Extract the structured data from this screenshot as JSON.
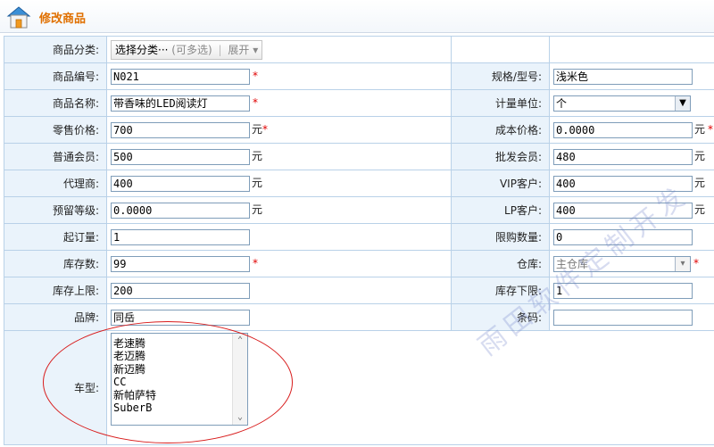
{
  "header": {
    "title": "修改商品",
    "icon": "home-icon"
  },
  "form": {
    "category": {
      "label": "商品分类:",
      "button_label": "选择分类···",
      "hint": "(可多选)",
      "expand_label": "展开"
    },
    "code": {
      "label": "商品编号:",
      "value": "N021"
    },
    "spec": {
      "label": "规格/型号:",
      "value": "浅米色"
    },
    "name": {
      "label": "商品名称:",
      "value": "带香味的LED阅读灯"
    },
    "unit_measure": {
      "label": "计量单位:",
      "value": "个"
    },
    "retail_price": {
      "label": "零售价格:",
      "value": "700",
      "unit": "元"
    },
    "cost_price": {
      "label": "成本价格:",
      "value": "0.0000",
      "unit": "元"
    },
    "member_price": {
      "label": "普通会员:",
      "value": "500",
      "unit": "元"
    },
    "wholesale_price": {
      "label": "批发会员:",
      "value": "480",
      "unit": "元"
    },
    "agent_price": {
      "label": "代理商:",
      "value": "400",
      "unit": "元"
    },
    "vip_price": {
      "label": "VIP客户:",
      "value": "400",
      "unit": "元"
    },
    "reserved_level": {
      "label": "预留等级:",
      "value": "0.0000",
      "unit": "元"
    },
    "lp_price": {
      "label": "LP客户:",
      "value": "400",
      "unit": "元"
    },
    "min_order": {
      "label": "起订量:",
      "value": "1"
    },
    "max_purchase": {
      "label": "限购数量:",
      "value": "0"
    },
    "stock": {
      "label": "库存数:",
      "value": "99"
    },
    "warehouse": {
      "label": "仓库:",
      "value": "主仓库"
    },
    "stock_max": {
      "label": "库存上限:",
      "value": "200"
    },
    "stock_min": {
      "label": "库存下限:",
      "value": "1"
    },
    "brand": {
      "label": "品牌:",
      "value": "同岳"
    },
    "barcode": {
      "label": "条码:",
      "value": ""
    },
    "car_model": {
      "label": "车型:",
      "options": [
        "老速腾",
        "老迈腾",
        "新迈腾",
        "CC",
        "新帕萨特",
        "SuberB"
      ]
    },
    "required_mark": "*"
  },
  "watermark": "雨田软件定制开发",
  "colors": {
    "label_bg": "#eaf3fb",
    "border": "#b9d1e8",
    "title": "#e07000",
    "required": "#e00000",
    "annotation": "#d81c1c"
  }
}
